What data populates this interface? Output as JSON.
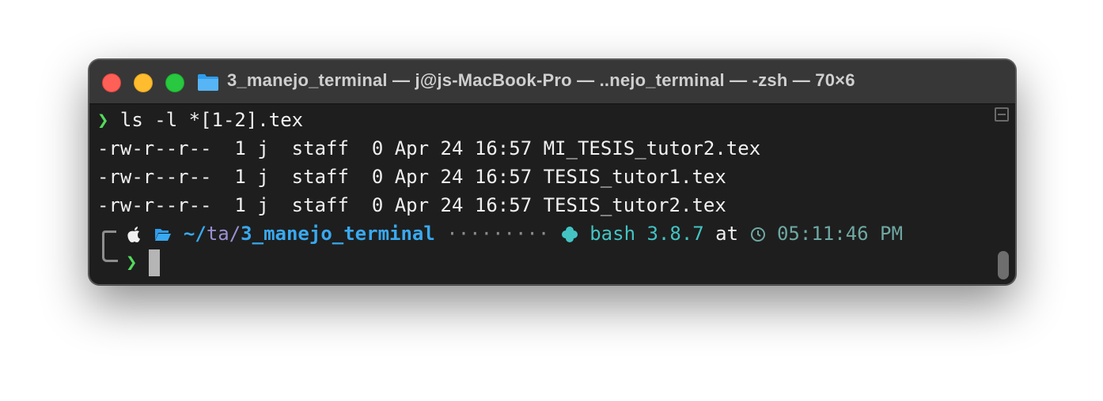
{
  "window": {
    "title": "3_manejo_terminal — j@js-MacBook-Pro — ..nejo_terminal — -zsh — 70×6",
    "folder_icon": "folder-icon"
  },
  "command": {
    "prompt_symbol": "❯",
    "text": " ls -l *[1-2].tex"
  },
  "listing": [
    {
      "perms": "-rw-r--r--",
      "links": "1",
      "owner": "j",
      "group": "staff",
      "size": "0",
      "month": "Apr",
      "day": "24",
      "time": "16:57",
      "name": "MI_TESIS_tutor2.tex"
    },
    {
      "perms": "-rw-r--r--",
      "links": "1",
      "owner": "j",
      "group": "staff",
      "size": "0",
      "month": "Apr",
      "day": "24",
      "time": "16:57",
      "name": "TESIS_tutor1.tex"
    },
    {
      "perms": "-rw-r--r--",
      "links": "1",
      "owner": "j",
      "group": "staff",
      "size": "0",
      "month": "Apr",
      "day": "24",
      "time": "16:57",
      "name": "TESIS_tutor2.tex"
    }
  ],
  "prompt": {
    "os_icon": "apple-icon",
    "dir_icon": "open-folder-icon",
    "path_prefix": "~/",
    "path_mid": "ta/",
    "path_current": "3_manejo_terminal",
    "dots": "·········",
    "shell_icon": "clover-icon",
    "shell": "bash 3.8.7",
    "at": "at",
    "clock_icon": "clock-icon",
    "time": "05:11:46 PM",
    "input_symbol": "❯"
  },
  "colors": {
    "green": "#53d95c",
    "blue": "#39a9f0",
    "teal": "#44c3c3"
  }
}
